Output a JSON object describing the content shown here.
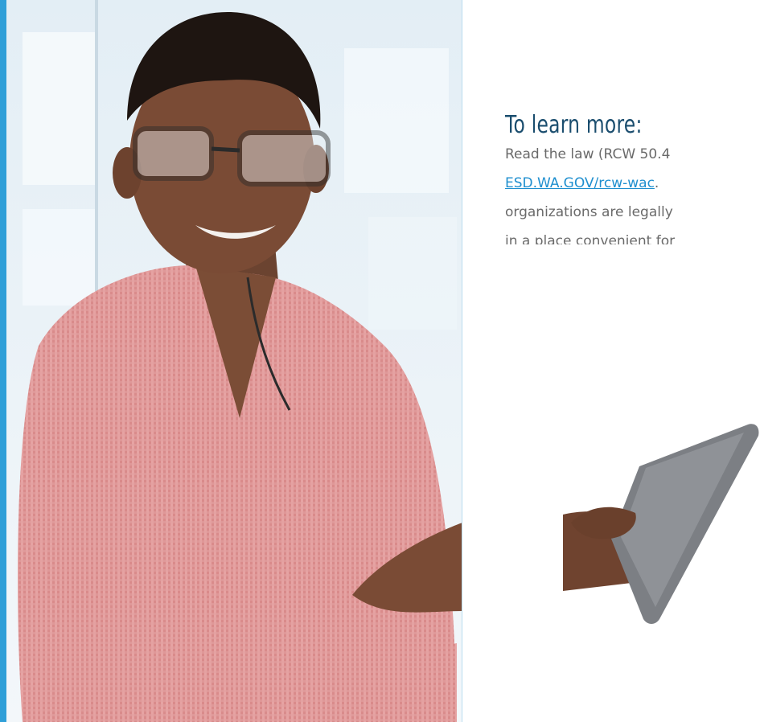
{
  "section": {
    "heading": "To learn more:",
    "body": {
      "line1": "Read the law (RCW 50.4",
      "link_text": "ESD.WA.GOV/rcw-wac",
      "line2_suffix": ".",
      "line3": "organizations are legally",
      "line4": "in a place convenient for"
    }
  },
  "photo": {
    "subject_icon": "person-with-tablet-photo"
  },
  "colors": {
    "accent": "#2f9fd8",
    "heading": "#1a4d6e",
    "link": "#1f8fcf",
    "body_text": "#6a6a6a"
  }
}
